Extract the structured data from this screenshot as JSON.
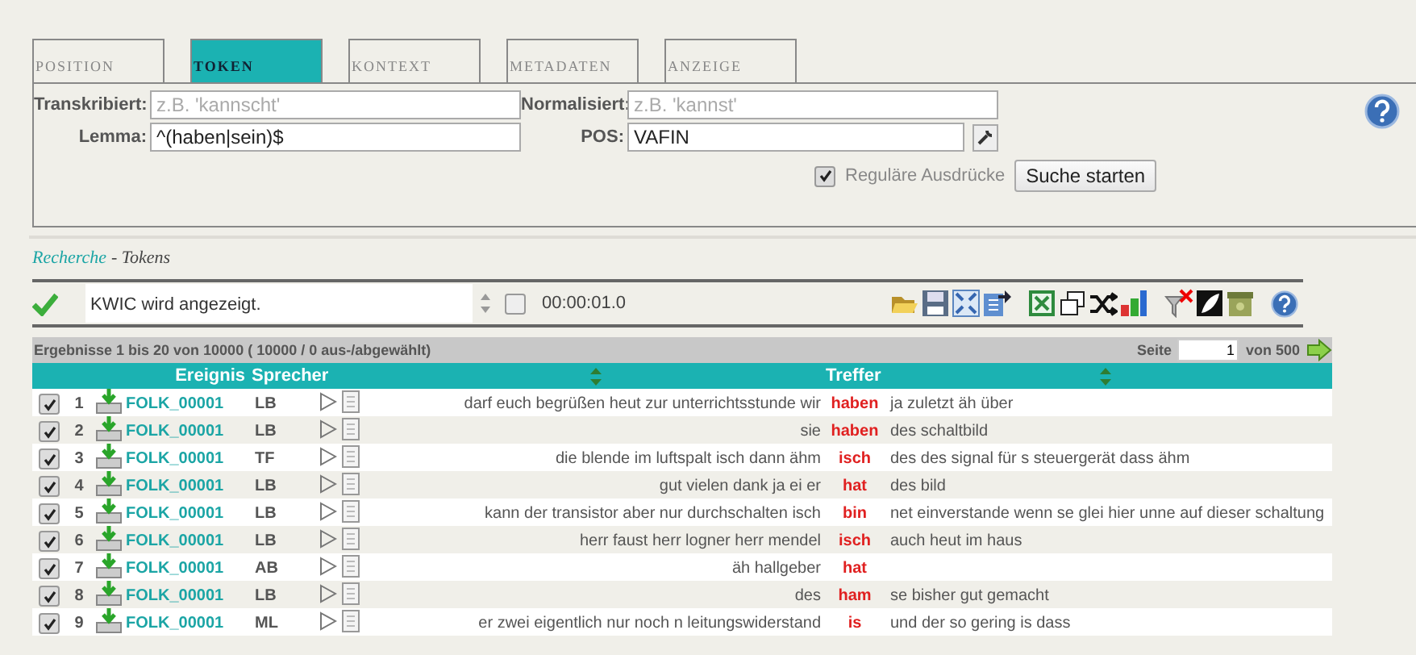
{
  "tabs": [
    {
      "label": "POSITION",
      "selected": false
    },
    {
      "label": "TOKEN",
      "selected": true
    },
    {
      "label": "KONTEXT",
      "selected": false
    },
    {
      "label": "METADATEN",
      "selected": false
    },
    {
      "label": "ANZEIGE",
      "selected": false
    }
  ],
  "form": {
    "fields": [
      {
        "label": "Transkribiert:",
        "placeholder": "z.B. 'kannscht'"
      },
      {
        "label": "Normalisiert:",
        "placeholder": "z.B. 'kannst'"
      },
      {
        "label": "Lemma:",
        "value": "^(haben|sein)$"
      },
      {
        "label": "POS:",
        "value": "VAFIN"
      }
    ],
    "regex": {
      "label": "Reguläre Ausdrücke",
      "checked": true
    },
    "search_button": "Suche starten"
  },
  "breadcrumb": {
    "link": "Recherche",
    "current": "- Tokens"
  },
  "status": {
    "success": true,
    "message": "KWIC wird angezeigt.",
    "checked": false,
    "time": "00:00:01.0"
  },
  "results": {
    "summary": "Ergebnisse 1 bis 20 von 10000 ( 10000 / 0 aus-/abgewählt)",
    "page_label": "Seite",
    "page": "1",
    "page_total": "von 500"
  },
  "columns": [
    "Ereignis",
    "Sprecher",
    "Treffer"
  ],
  "rows": [
    {
      "number": "1",
      "checked": true,
      "event": "FOLK_00001",
      "speaker": "LB",
      "left": "darf euch begrüßen heut zur unterrichtsstunde wir",
      "hit": "haben",
      "right": "ja zuletzt äh über"
    },
    {
      "number": "2",
      "checked": true,
      "event": "FOLK_00001",
      "speaker": "LB",
      "left": "sie",
      "hit": "haben",
      "right": "des schaltbild"
    },
    {
      "number": "3",
      "checked": true,
      "event": "FOLK_00001",
      "speaker": "TF",
      "left": "die blende im luftspalt isch dann ähm",
      "hit": "isch",
      "right": "des des signal für s steuergerät dass ähm"
    },
    {
      "number": "4",
      "checked": true,
      "event": "FOLK_00001",
      "speaker": "LB",
      "left": "gut vielen dank ja ei er",
      "hit": "hat",
      "right": "des bild"
    },
    {
      "number": "5",
      "checked": true,
      "event": "FOLK_00001",
      "speaker": "LB",
      "left": "kann der transistor aber nur durchschalten isch",
      "hit": "bin",
      "right": "net einverstande wenn se glei hier unne auf dieser schaltung"
    },
    {
      "number": "6",
      "checked": true,
      "event": "FOLK_00001",
      "speaker": "LB",
      "left": "herr faust herr logner herr mendel",
      "hit": "isch",
      "right": "auch heut im haus"
    },
    {
      "number": "7",
      "checked": true,
      "event": "FOLK_00001",
      "speaker": "AB",
      "left": "äh hallgeber",
      "hit": "hat",
      "right": ""
    },
    {
      "number": "8",
      "checked": true,
      "event": "FOLK_00001",
      "speaker": "LB",
      "left": "des",
      "hit": "ham",
      "right": "se bisher gut gemacht"
    },
    {
      "number": "9",
      "checked": true,
      "event": "FOLK_00001",
      "speaker": "ML",
      "left": "er zwei eigentlich nur noch n leitungswiderstand",
      "hit": "is",
      "right": "und der so gering is dass"
    }
  ]
}
